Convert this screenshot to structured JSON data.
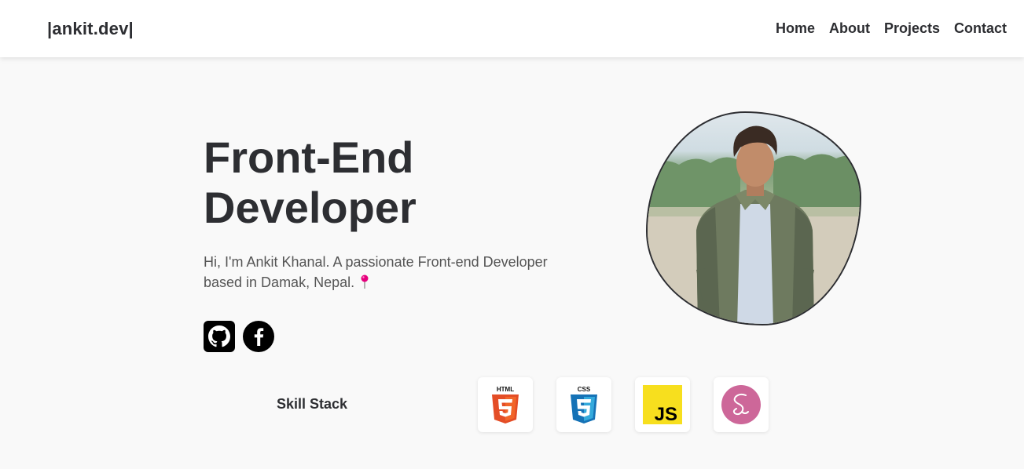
{
  "navbar": {
    "logo": "|ankit.dev|",
    "links": [
      "Home",
      "About",
      "Projects",
      "Contact"
    ]
  },
  "hero": {
    "title_line1": "Front-End",
    "title_line2": "Developer",
    "description": "Hi, I'm Ankit Khanal. A passionate Front-end Developer based in Damak, Nepal.",
    "socials": [
      "github-icon",
      "facebook-icon"
    ]
  },
  "skills": {
    "title": "Skill Stack",
    "items": [
      {
        "icon": "html5-icon",
        "label": "HTML"
      },
      {
        "icon": "css3-icon",
        "label": "CSS"
      },
      {
        "icon": "javascript-icon",
        "label": "JS"
      },
      {
        "icon": "sass-icon"
      }
    ]
  },
  "colors": {
    "text": "#2d2e32",
    "background": "#f9f9f9",
    "html": "#e44d26",
    "css": "#1572b6",
    "js": "#f7df1e",
    "sass": "#cd6799",
    "pin": "#e6007e"
  }
}
